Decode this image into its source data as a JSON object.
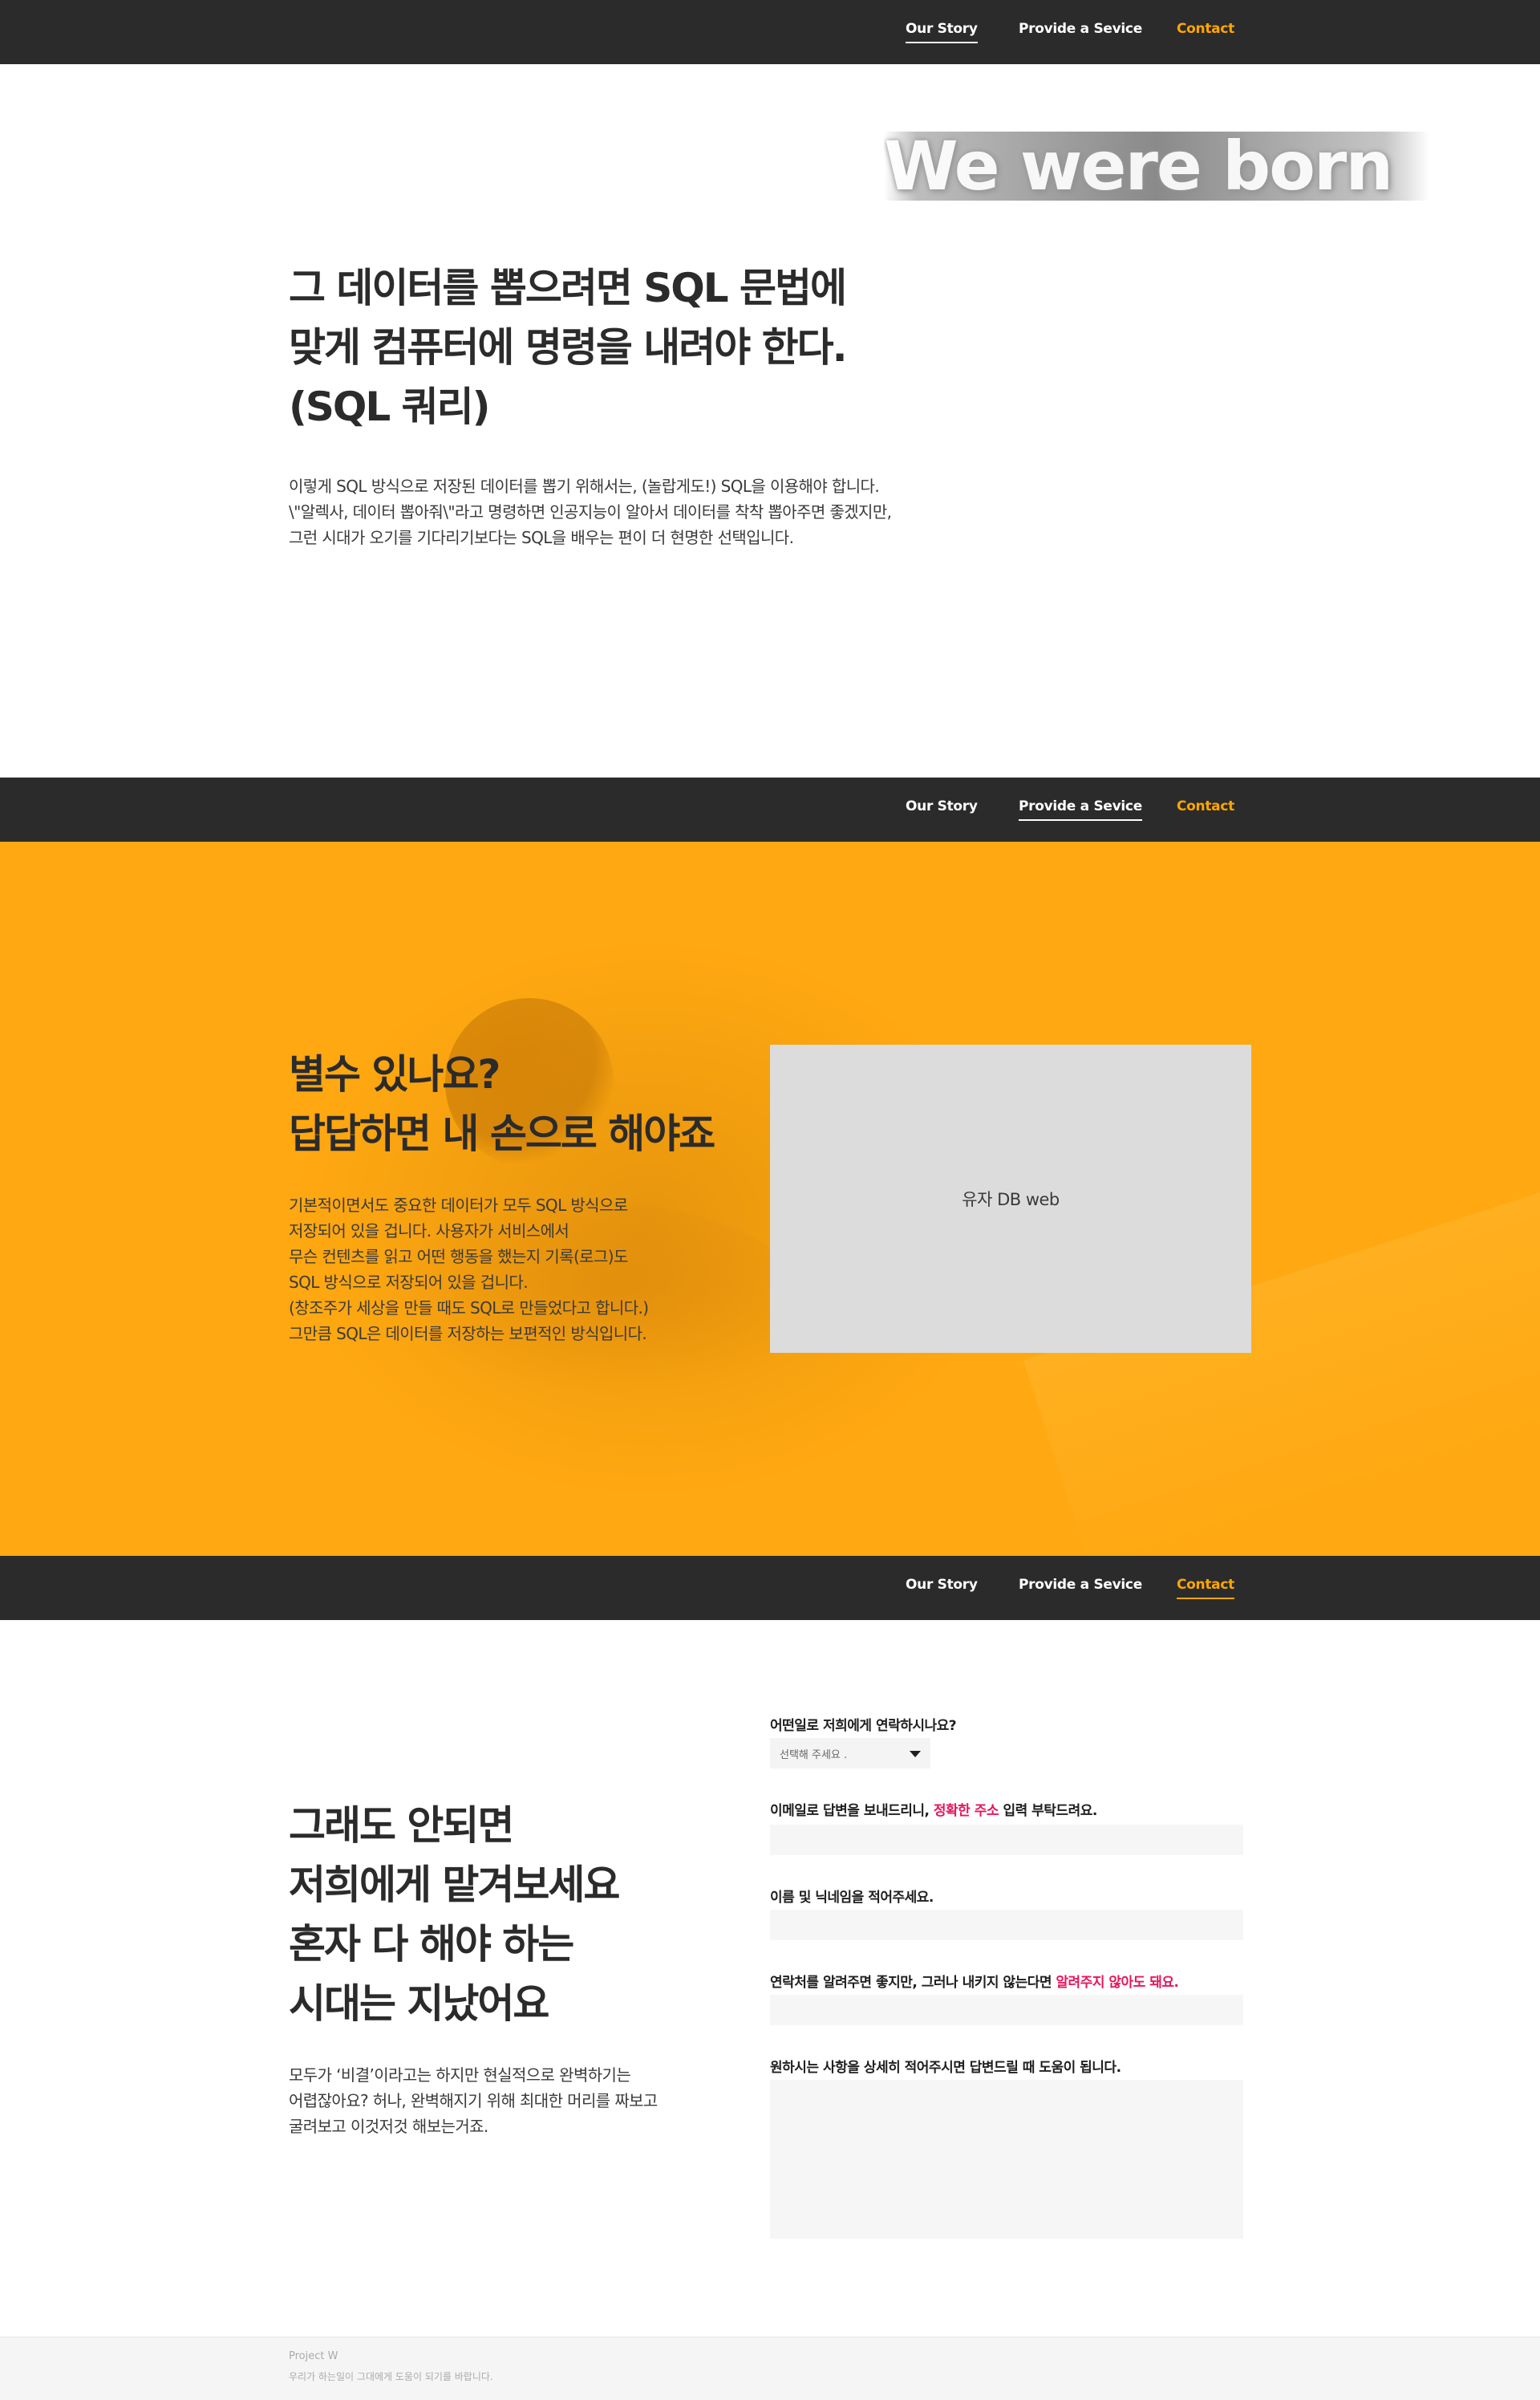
{
  "nav": {
    "our_story": "Our Story",
    "provide": "Provide a Sevice",
    "contact": "Contact"
  },
  "story": {
    "hero_word": "We were born",
    "heading": [
      "그 데이터를 뽑으려면 SQL 문법에",
      "맞게 컴퓨터에 명령을 내려야 한다.",
      "(SQL 쿼리)"
    ],
    "paragraph": [
      "이렇게 SQL 방식으로 저장된 데이터를 뽑기 위해서는, (놀랍게도!) SQL을 이용해야 합니다.",
      "\\\"알렉사, 데이터 뽑아줘\\\"라고 명령하면 인공지능이 알아서 데이터를 착착 뽑아주면 좋겠지만,",
      "그런 시대가 오기를 기다리기보다는 SQL을 배우는 편이 더 현명한 선택입니다."
    ]
  },
  "service": {
    "heading": [
      "별수 있나요?",
      "답답하면 내 손으로 해야죠"
    ],
    "paragraph": [
      "기본적이면서도 중요한 데이터가 모두 SQL 방식으로",
      "저장되어 있을 겁니다. 사용자가 서비스에서",
      "무슨 컨텐츠를 읽고 어떤 행동을 했는지 기록(로그)도",
      "SQL 방식으로 저장되어 있을 겁니다.",
      "(창조주가 세상을 만들 때도 SQL로 만들었다고 합니다.)",
      "그만큼 SQL은 데이터를 저장하는 보편적인 방식입니다."
    ],
    "image_label": "유자 DB web"
  },
  "contact": {
    "heading": [
      "그래도 안되면",
      "저희에게 맡겨보세요",
      "혼자 다 해야 하는",
      "시대는 지났어요"
    ],
    "paragraph": [
      "모두가 ‘비결’이라고는 하지만 현실적으로 완벽하기는",
      "어렵잖아요? 허나, 완벽해지기 위해 최대한 머리를 짜보고",
      "굴려보고 이것저것 해보는거죠."
    ],
    "form": {
      "q1": "어떤일로 저희에게 연락하시나요?",
      "select_value": "선택해 주세요 .",
      "q2_pre": "이메일로 답변을 보내드리니, ",
      "q2_hl": "정확한 주소",
      "q2_post": " 입력 부탁드려요.",
      "q3": "이름 및 닉네임을 적어주세요.",
      "q4_pre": "연락처를 알려주면 좋지만, 그러나 내키지 않는다면 ",
      "q4_hl": "알려주지 않아도 돼요.",
      "q5": "원하시는 사항을 상세히 적어주시면 답변드릴 때 도움이 됩니다."
    }
  },
  "footer": {
    "name": "Project W",
    "tagline": "우리가 하는일이 그대에게 도움이 되기를 바랍니다."
  },
  "colors": {
    "nav_bg": "#2b2b2b",
    "accent_orange": "#ffa600",
    "highlight_red": "#e6175a",
    "band_orange": "#ffa811"
  }
}
